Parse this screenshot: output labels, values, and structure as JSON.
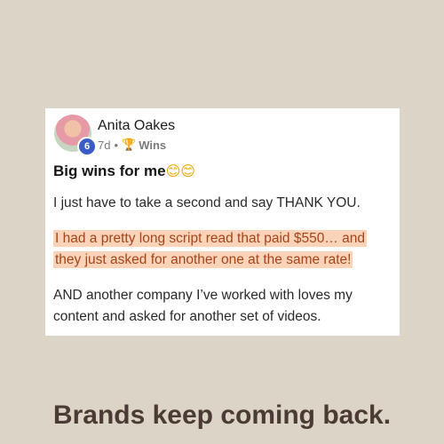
{
  "post": {
    "author": "Anita Oakes",
    "level": "6",
    "time": "7d",
    "separator": "•",
    "category_icon": "🏆",
    "category": "Wins",
    "title": "Big wins for me",
    "title_emojis": "😊😊",
    "paragraph_1": "I just have to take a second and say THANK YOU.",
    "highlight": "I had a pretty long script read that paid $550… and they just asked for another one at the same rate!",
    "paragraph_2": "AND another company I’ve worked with loves my content and asked for another set of videos."
  },
  "caption": "Brands keep coming back.",
  "colors": {
    "background": "#dcd4c7",
    "highlight_bg": "#fbd3b8",
    "highlight_text": "#a4451b",
    "badge": "#3b5cc6",
    "caption": "#4a3c34"
  }
}
